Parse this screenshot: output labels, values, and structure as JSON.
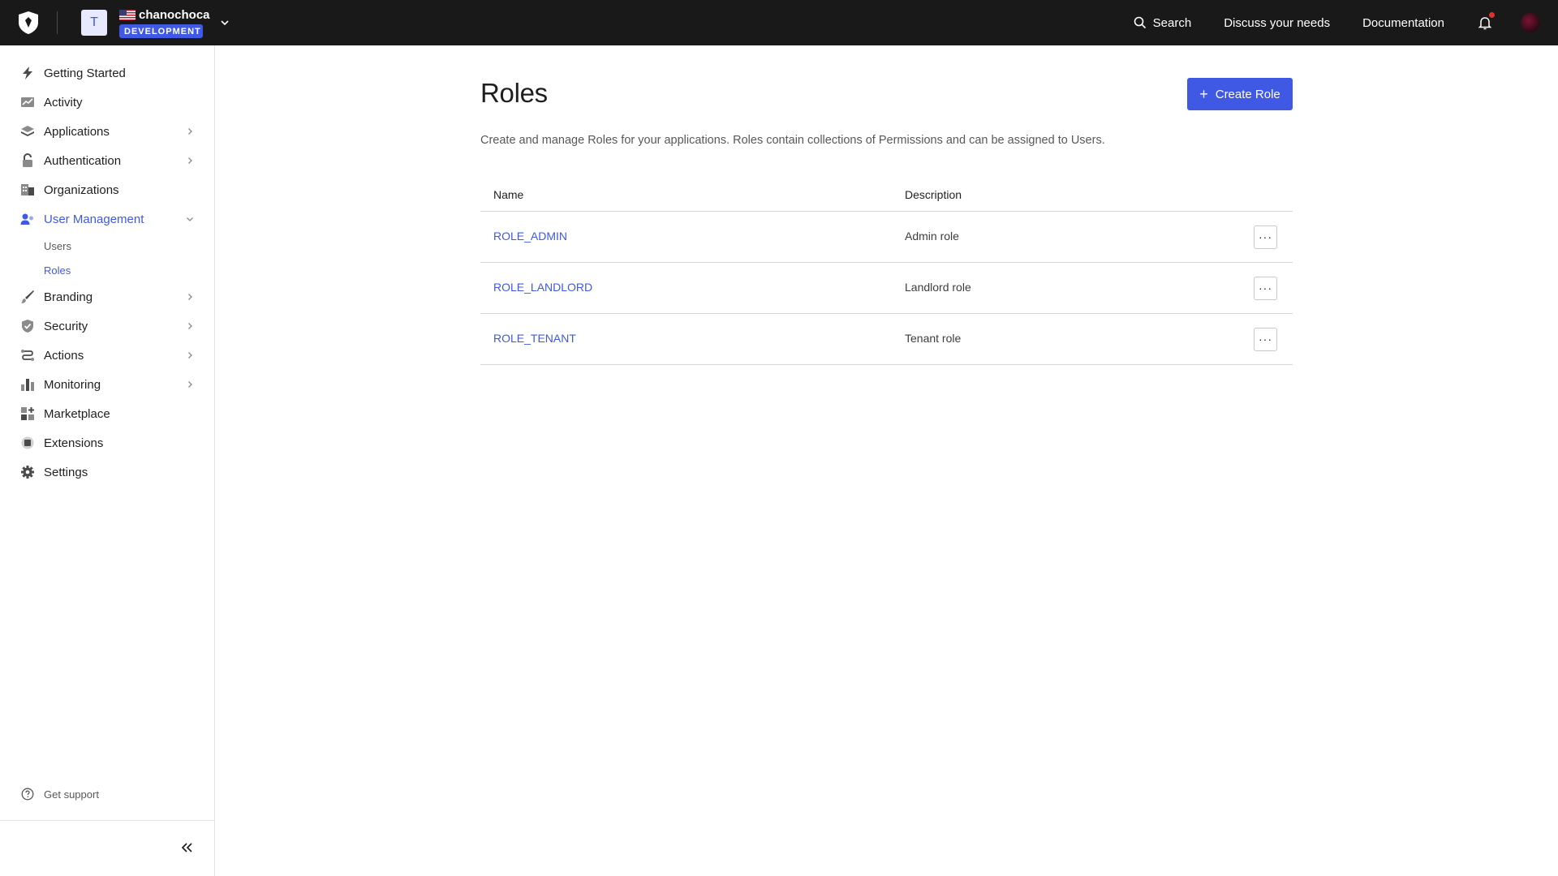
{
  "topbar": {
    "tenant": {
      "avatar_letter": "T",
      "name": "chanochoca",
      "environment": "DEVELOPMENT"
    },
    "nav": {
      "search_label": "Search",
      "discuss_label": "Discuss your needs",
      "docs_label": "Documentation"
    }
  },
  "sidebar": {
    "items": [
      {
        "label": "Getting Started"
      },
      {
        "label": "Activity"
      },
      {
        "label": "Applications"
      },
      {
        "label": "Authentication"
      },
      {
        "label": "Organizations"
      },
      {
        "label": "User Management"
      },
      {
        "label": "Branding"
      },
      {
        "label": "Security"
      },
      {
        "label": "Actions"
      },
      {
        "label": "Monitoring"
      },
      {
        "label": "Marketplace"
      },
      {
        "label": "Extensions"
      },
      {
        "label": "Settings"
      }
    ],
    "sub_items": [
      {
        "label": "Users"
      },
      {
        "label": "Roles"
      }
    ],
    "support_label": "Get support"
  },
  "main": {
    "title": "Roles",
    "create_label": "Create Role",
    "description": "Create and manage Roles for your applications. Roles contain collections of Permissions and can be assigned to Users.",
    "table": {
      "headers": {
        "name": "Name",
        "description": "Description"
      },
      "rows": [
        {
          "name": "ROLE_ADMIN",
          "description": "Admin role"
        },
        {
          "name": "ROLE_LANDLORD",
          "description": "Landlord role"
        },
        {
          "name": "ROLE_TENANT",
          "description": "Tenant role"
        }
      ],
      "more_label": "···"
    }
  },
  "colors": {
    "accent": "#3f59e4",
    "topbar_bg": "#191919",
    "notification_dot": "#e0312c"
  }
}
